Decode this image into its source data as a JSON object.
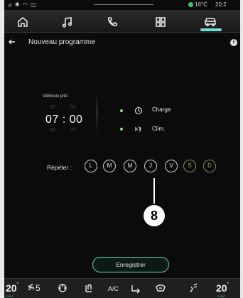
{
  "status": {
    "signal_icons": "⊿ ✱ ◠ ◫",
    "temperature": "16°C",
    "time": "20:2"
  },
  "nav": {
    "items": [
      "home-icon",
      "music-icon",
      "phone-icon",
      "apps-icon",
      "vehicle-icon"
    ],
    "active": "vehicle-icon"
  },
  "header": {
    "title": "Nouveau programme"
  },
  "schedule": {
    "vehicle_ready_label": "Véhicule prêt",
    "hour_above": "06",
    "minute_above": "55",
    "time_display": "07 : 00",
    "hour_below": "08",
    "minute_below": "05",
    "options": [
      {
        "label": "Charge",
        "icon": "clock-icon"
      },
      {
        "label": "Clim.",
        "icon": "climate-icon"
      }
    ]
  },
  "repeat": {
    "label": "Répéter :",
    "days": [
      "L",
      "M",
      "M",
      "J",
      "V",
      "S",
      "D"
    ],
    "selected": [
      true,
      true,
      true,
      true,
      true,
      false,
      false
    ]
  },
  "callout": {
    "number": "8"
  },
  "save_button": {
    "label": "Enregistrer"
  },
  "bottom_bar": {
    "left_temp": "20",
    "left_temp_unit": "°",
    "fan_level": "5",
    "ac_label": "A/C",
    "right_temp": "20",
    "right_temp_unit": "°",
    "left_sub": "SYNC",
    "right_sub": "SYNC"
  },
  "colors": {
    "accent": "#59d6a6",
    "active_nav": "#6ee0cf",
    "status_green": "#2ecc71",
    "option_dot": "#8fe07a",
    "weekend_day": "#a6a65e"
  }
}
